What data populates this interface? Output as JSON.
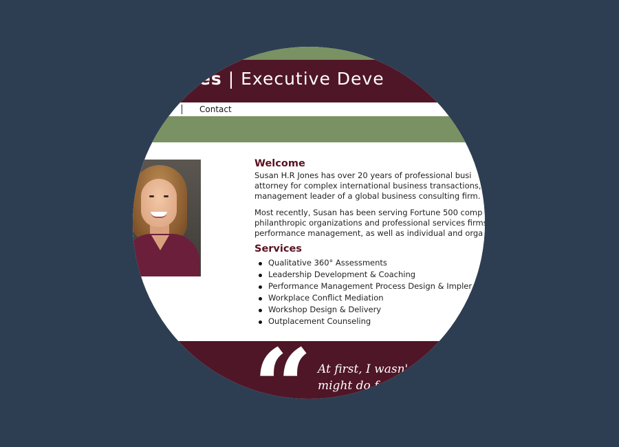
{
  "header": {
    "name_fragment": "ones",
    "separator": " | ",
    "subtitle": "Executive Deve"
  },
  "nav": {
    "contact_label": "Contact"
  },
  "welcome": {
    "heading": "Welcome",
    "para1_lines": [
      "Susan H.R Jones has over 20 years of professional busi",
      "attorney for complex international business transactions,",
      "management leader of a global business consulting firm."
    ],
    "para2_lines": [
      "Most recently, Susan has been serving Fortune 500 comp",
      "philanthropic organizations and professional services firms",
      "performance management, as well as individual and orga"
    ]
  },
  "services": {
    "heading": "Services",
    "items": [
      "Qualitative 360° Assessments",
      "Leadership Development & Coaching",
      "Performance Management Process Design & Impler",
      "Workplace Conflict Mediation",
      "Workshop Design & Delivery",
      "Outplacement Counseling"
    ]
  },
  "testimonial": {
    "line1": "At first, I wasn'",
    "line2": "might do f"
  },
  "colors": {
    "background": "#2e3e52",
    "maroon": "#4f1627",
    "green": "#7a9163",
    "heading": "#5a1220"
  }
}
